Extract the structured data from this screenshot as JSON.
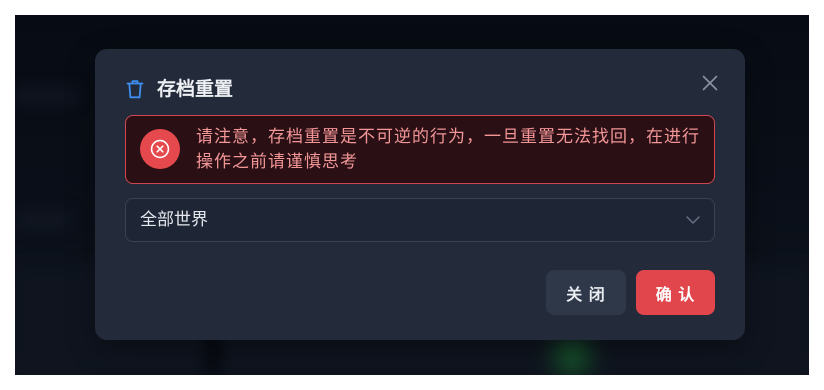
{
  "dialog": {
    "title": "存档重置",
    "title_icon": "trash-icon",
    "close_icon": "close-icon",
    "alert": {
      "icon": "circle-x-icon",
      "lines": [
        "请注意，存档重置是不可逆的行为，一旦重置无法找回，在进行",
        "操作之前请谨慎思考"
      ]
    },
    "world_select": {
      "value": "全部世界",
      "icon": "chevron-down-icon"
    },
    "buttons": {
      "close": "关 闭",
      "confirm": "确 认"
    }
  },
  "colors": {
    "accent": "#3d8ef0",
    "danger": "#e5484d",
    "danger-bg": "#2a0f15",
    "danger-border": "#cf4650",
    "danger-text": "#f29696",
    "dialog-bg": "#232b3b",
    "backdrop": "#0c111a",
    "secondary-button": "#2f3848",
    "primary-button": "#e0464c"
  }
}
